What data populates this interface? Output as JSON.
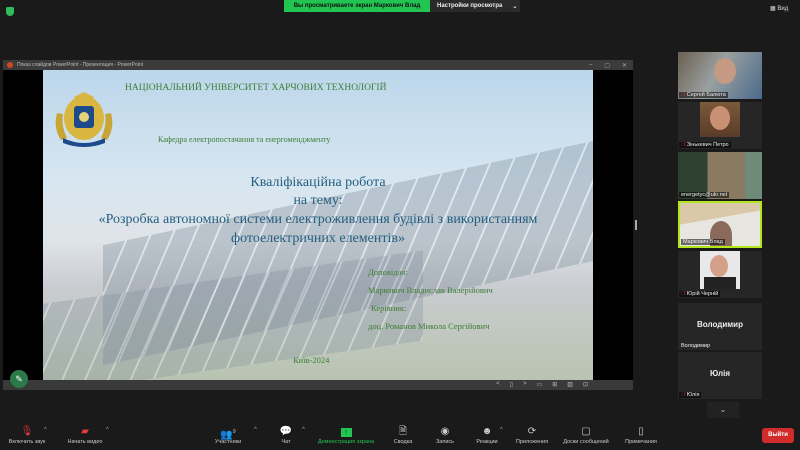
{
  "banner": {
    "viewing": "Вы просматриваете экран Маркович Влад",
    "view_options": "Настройки просмотра",
    "view_button": "Вид"
  },
  "window": {
    "title": "Показ слайдов PowerPoint  -  Презентация  -  PowerPoint",
    "controls": [
      "–",
      "▢",
      "✕"
    ]
  },
  "slide": {
    "university": "НАЦІОНАЛЬНИЙ УНІВЕРСИТЕТ ХАРЧОВИХ ТЕХНОЛОГІЙ",
    "department": "Кафедра електропостачання та енергоменджменту",
    "title1": "Кваліфікаційна робота",
    "title2": "на тему:",
    "title3": "«Розробка автономної системи електроживлення будівлі з використанням",
    "title4": "фотоелектричних елементів»",
    "speaker_label": "Доповідач:",
    "speaker": "Маркович Владислав Валерійович",
    "supervisor_label": "Керівник:",
    "supervisor": "доц. Романов Микола Сергійович",
    "city_year": "Київ-2024"
  },
  "slidebar": {
    "prev": "<",
    "next": ">"
  },
  "participants": [
    {
      "name": "Сергей Балюта",
      "muted": true
    },
    {
      "name": "Зінькевич Петро",
      "muted": true
    },
    {
      "name": "energetyc@ukr.net",
      "muted": false
    },
    {
      "name": "Маркович Влад",
      "muted": false
    },
    {
      "name": "Юрій Черній",
      "muted": true
    },
    {
      "name": "Володимир",
      "muted": false,
      "initials": "Володимир"
    },
    {
      "name": "Юлія",
      "muted": true,
      "initials": "Юлія"
    }
  ],
  "toolbar": {
    "unmute": "Включить звук",
    "video": "Начать видео",
    "participants": "Участники",
    "participants_count": "9",
    "chat": "Чат",
    "share": "Демонстрация экрана",
    "summary": "Сводка",
    "record": "Запись",
    "reactions": "Реакции",
    "apps": "Приложения",
    "whiteboards": "Доски сообщений",
    "notes": "Примечания",
    "leave": "Выйти"
  },
  "colors": {
    "accent_green": "#23c552",
    "leave_red": "#d02c2c",
    "active_border": "#b5e61d"
  }
}
